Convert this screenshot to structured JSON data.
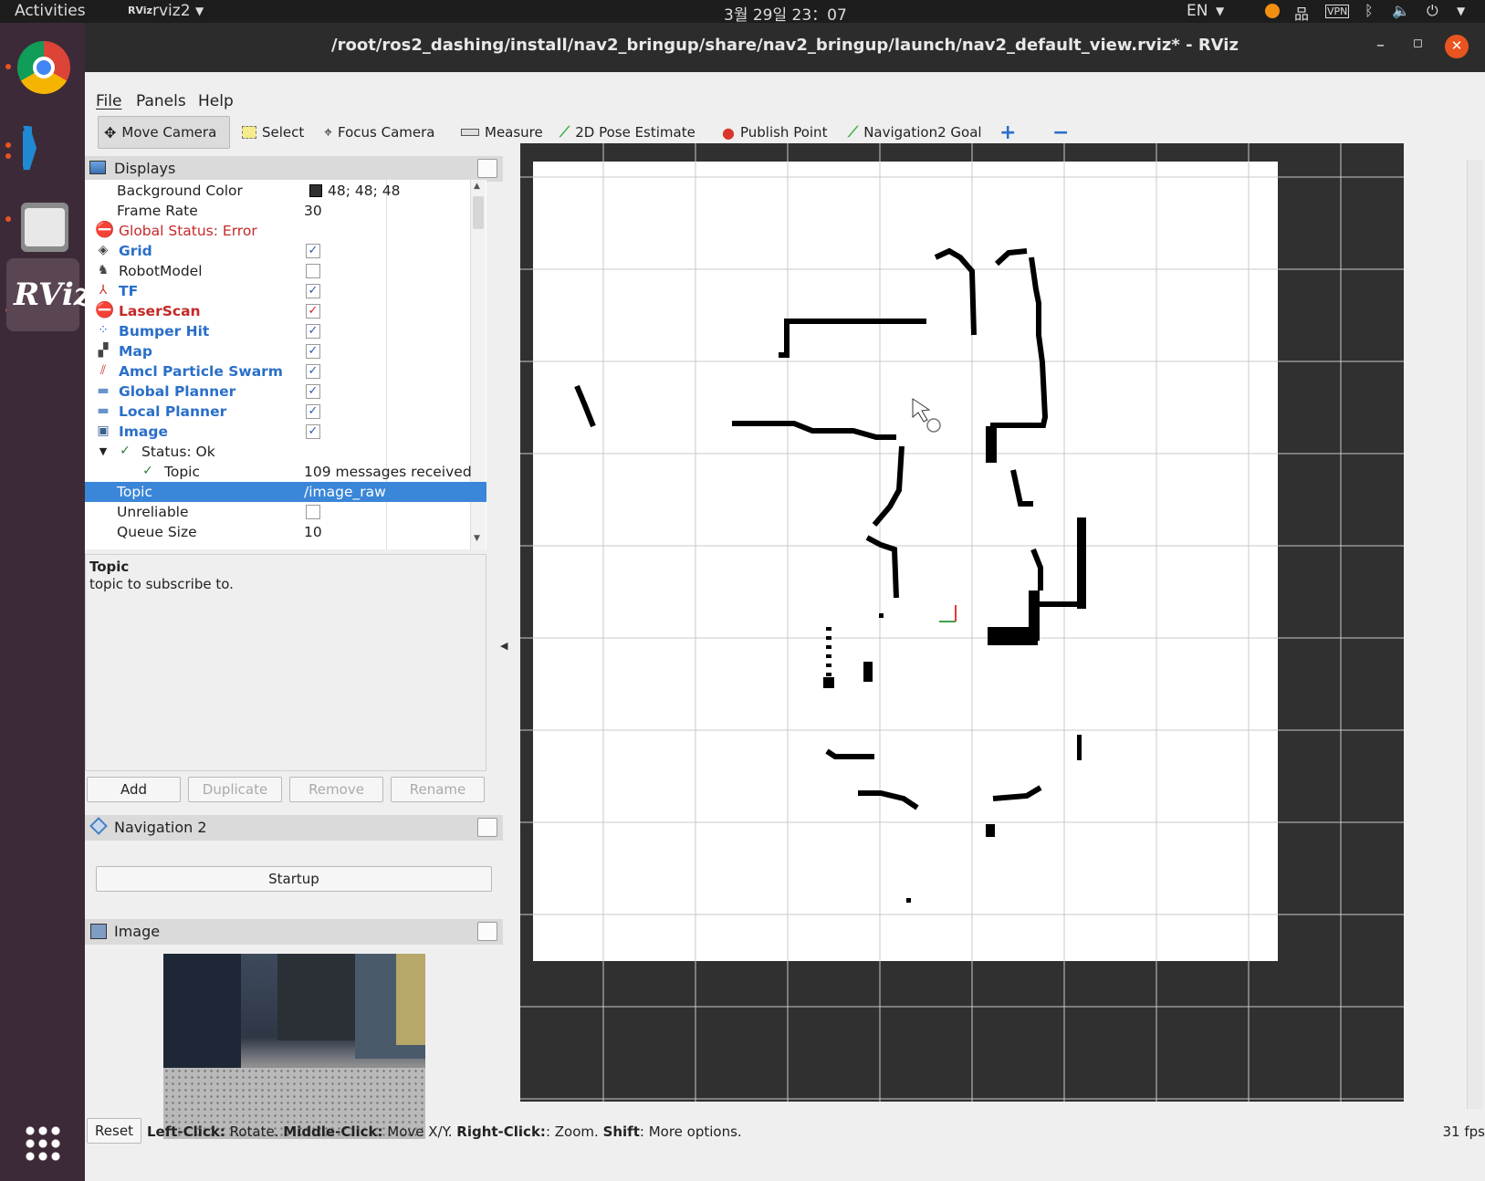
{
  "topbar": {
    "activities": "Activities",
    "app": "rviz2",
    "clock": "3월 29일  23：07",
    "lang": "EN"
  },
  "window": {
    "title": "/root/ros2_dashing/install/nav2_bringup/share/nav2_bringup/launch/nav2_default_view.rviz* - RViz"
  },
  "menu": {
    "file": "File",
    "panels": "Panels",
    "help": "Help"
  },
  "toolbar": {
    "move_camera": "Move Camera",
    "select": "Select",
    "focus_camera": "Focus Camera",
    "measure": "Measure",
    "pose_estimate": "2D Pose Estimate",
    "publish_point": "Publish Point",
    "nav_goal": "Navigation2 Goal"
  },
  "displays": {
    "title": "Displays",
    "rows": [
      {
        "name": "Background Color",
        "value": "48; 48; 48"
      },
      {
        "name": "Frame Rate",
        "value": "30"
      },
      {
        "name": "Global Status: Error"
      },
      {
        "name": "Grid",
        "checked": true
      },
      {
        "name": "RobotModel",
        "checked": false
      },
      {
        "name": "TF",
        "checked": true
      },
      {
        "name": "LaserScan",
        "checked": true
      },
      {
        "name": "Bumper Hit",
        "checked": true
      },
      {
        "name": "Map",
        "checked": true
      },
      {
        "name": "Amcl Particle Swarm",
        "checked": true
      },
      {
        "name": "Global Planner",
        "checked": true
      },
      {
        "name": "Local Planner",
        "checked": true
      },
      {
        "name": "Image",
        "checked": true
      },
      {
        "name": "Status: Ok"
      },
      {
        "name": "Topic",
        "value": "109 messages received"
      },
      {
        "name": "Topic",
        "value": "/image_raw"
      },
      {
        "name": "Unreliable",
        "checked": false
      },
      {
        "name": "Queue Size",
        "value": "10"
      }
    ],
    "description_title": "Topic",
    "description_text": "topic to subscribe to."
  },
  "buttons": {
    "add": "Add",
    "duplicate": "Duplicate",
    "remove": "Remove",
    "rename": "Rename"
  },
  "nav2": {
    "title": "Navigation 2",
    "startup": "Startup"
  },
  "image_panel": {
    "title": "Image"
  },
  "statusbar": {
    "reset": "Reset",
    "left_click": "Left-Click:",
    "left_click_action": " Rotate.",
    "middle_click": "Middle-Click:",
    "middle_click_action": " Move X/Y.",
    "right_click": "Right-Click:",
    "right_click_action": ": Zoom.",
    "shift": "Shift",
    "shift_action": ": More options.",
    "fps": "31 fps"
  },
  "colors": {
    "accent": "#3a86d8",
    "error": "#c62828",
    "link": "#2a6fc9",
    "background": "#303030"
  }
}
